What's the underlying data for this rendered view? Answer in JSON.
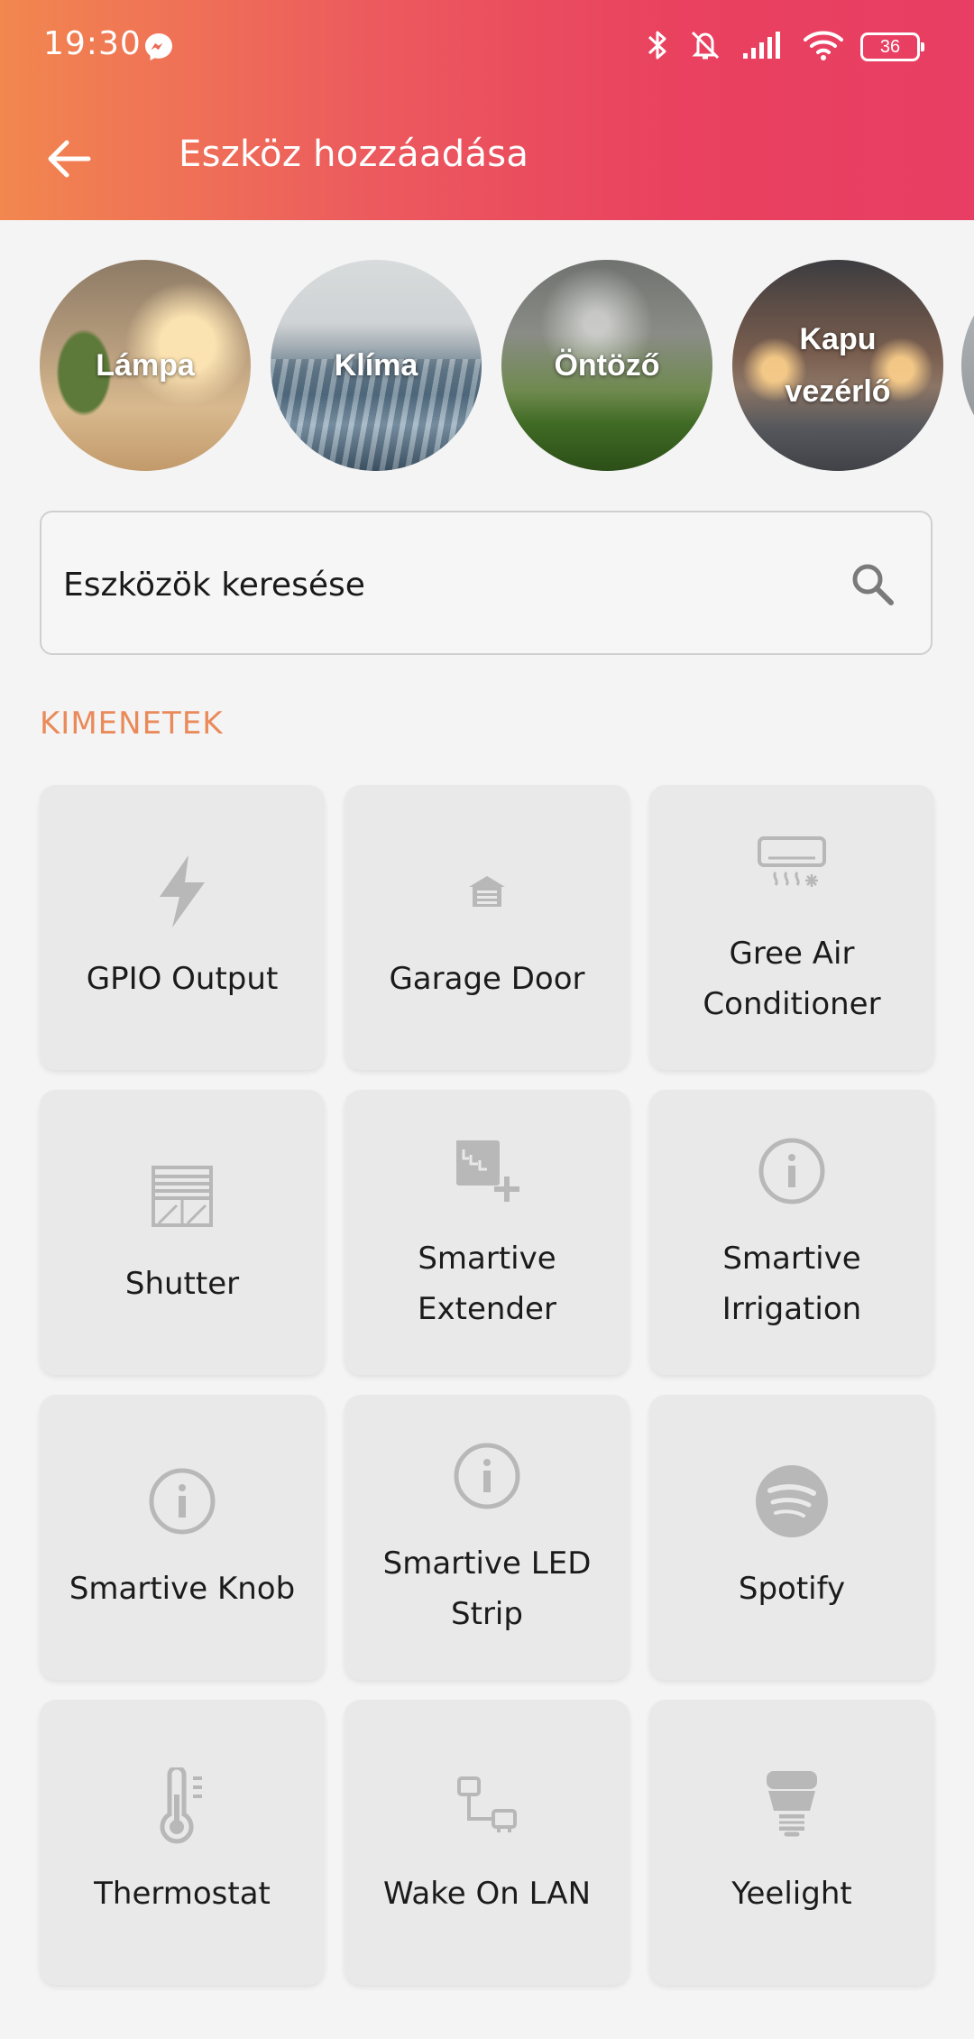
{
  "status_bar": {
    "time": "19:30",
    "battery": "36",
    "icons": [
      "messenger-icon",
      "bluetooth-icon",
      "mute-icon",
      "signal-icon",
      "wifi-icon",
      "battery-icon"
    ]
  },
  "header": {
    "title": "Eszköz hozzáadása"
  },
  "categories": [
    {
      "label": "Lámpa",
      "image": "lamp-photo"
    },
    {
      "label": "Klíma",
      "image": "air-conditioner-photo"
    },
    {
      "label": "Öntöző",
      "image": "sprinkler-photo"
    },
    {
      "label": "Kapu vezérlő",
      "image": "garage-gate-photo"
    }
  ],
  "search": {
    "placeholder": "Eszközök keresése"
  },
  "section": {
    "title": "KIMENETEK"
  },
  "devices": [
    {
      "label": "GPIO Output",
      "icon": "bolt-icon"
    },
    {
      "label": "Garage Door",
      "icon": "garage-icon"
    },
    {
      "label": "Gree Air Conditioner",
      "icon": "air-conditioner-icon"
    },
    {
      "label": "Shutter",
      "icon": "shutter-icon"
    },
    {
      "label": "Smartive Extender",
      "icon": "extender-icon"
    },
    {
      "label": "Smartive Irrigation",
      "icon": "info-icon"
    },
    {
      "label": "Smartive Knob",
      "icon": "info-icon"
    },
    {
      "label": "Smartive LED Strip",
      "icon": "info-icon"
    },
    {
      "label": "Spotify",
      "icon": "spotify-icon"
    },
    {
      "label": "Thermostat",
      "icon": "thermometer-icon"
    },
    {
      "label": "Wake On LAN",
      "icon": "network-icon"
    },
    {
      "label": "Yeelight",
      "icon": "bulb-icon"
    }
  ],
  "colors": {
    "header_gradient_start": "#f2874f",
    "header_gradient_end": "#e83e63",
    "section_title": "#ea8a5a",
    "tile_background": "#e9e9e9",
    "icon_gray": "#b8b8b8"
  }
}
